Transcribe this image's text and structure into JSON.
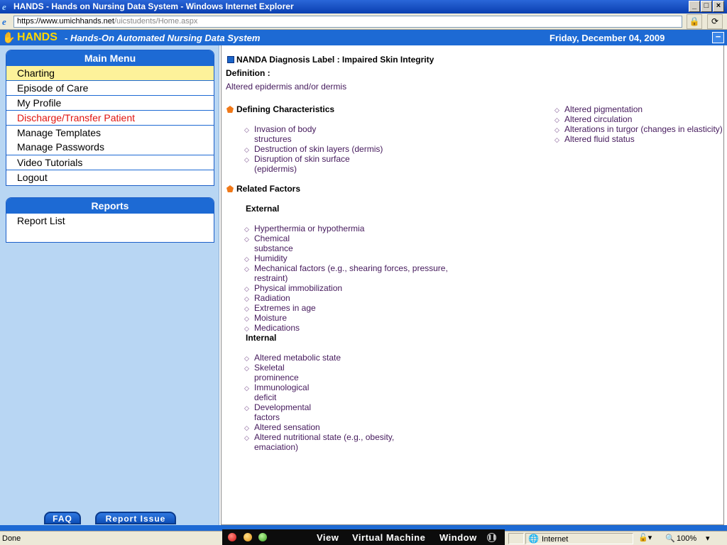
{
  "window": {
    "title": "HANDS - Hands on Nursing Data System - Windows Internet Explorer",
    "url_prefix": "https://",
    "url_domain": "www.umichhands.net",
    "url_path": "/uicstudents/Home.aspx"
  },
  "header": {
    "brand": "HANDS",
    "subtitle": "- Hands-On Automated Nursing Data System",
    "date": "Friday, December 04, 2009"
  },
  "main_menu": {
    "title": "Main Menu",
    "items": [
      {
        "label": "Charting"
      },
      {
        "label": "Episode of Care"
      },
      {
        "label": "My Profile"
      },
      {
        "label": "Discharge/Transfer Patient"
      },
      {
        "label": "Manage Templates"
      },
      {
        "label": "Manage Passwords"
      },
      {
        "label": "Video Tutorials"
      },
      {
        "label": "Logout"
      }
    ]
  },
  "reports": {
    "title": "Reports",
    "items": [
      {
        "label": "Report List"
      }
    ]
  },
  "footer_buttons": {
    "faq": "FAQ",
    "report_issue": "Report Issue"
  },
  "diagnosis": {
    "label": "NANDA Diagnosis Label : Impaired Skin Integrity",
    "definition_heading": "Definition :",
    "definition": "Altered epidermis and/or dermis",
    "defining_heading": "Defining Characteristics",
    "defining_left": [
      [
        "Invasion of body",
        "structures"
      ],
      [
        "Destruction of skin layers (dermis)"
      ],
      [
        "Disruption of skin surface",
        "(epidermis)"
      ]
    ],
    "defining_right": [
      "Altered pigmentation",
      "Altered circulation",
      "Alterations in turgor (changes in elasticity)",
      "Altered fluid status"
    ],
    "related_heading": "Related Factors",
    "external_heading": "External",
    "external": [
      [
        "Hyperthermia or hypothermia"
      ],
      [
        "Chemical",
        "substance"
      ],
      [
        "Humidity"
      ],
      [
        "Mechanical factors (e.g., shearing forces, pressure,",
        "restraint)"
      ],
      [
        "Physical immobilization"
      ],
      [
        "Radiation"
      ],
      [
        "Extremes in age"
      ],
      [
        "Moisture"
      ],
      [
        "Medications"
      ]
    ],
    "internal_heading": "Internal",
    "internal": [
      [
        "Altered metabolic state"
      ],
      [
        "Skeletal",
        "prominence"
      ],
      [
        "Immunological",
        "deficit"
      ],
      [
        "Developmental",
        "factors"
      ],
      [
        "Altered sensation"
      ],
      [
        "Altered nutritional state (e.g., obesity,",
        "emaciation)"
      ]
    ]
  },
  "statusbar": {
    "status": "Done",
    "zone": "Internet",
    "zoom": "100%"
  },
  "vm_bar": {
    "items": [
      "View",
      "Virtual Machine",
      "Window"
    ]
  }
}
